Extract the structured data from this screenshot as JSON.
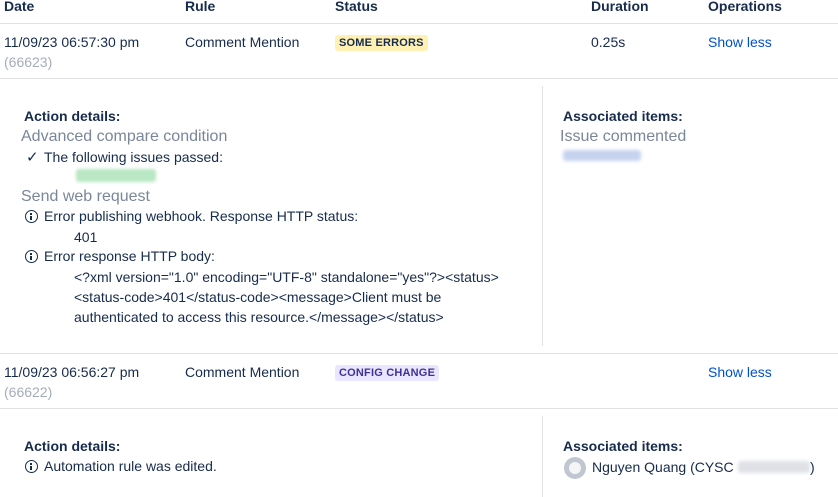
{
  "table": {
    "columns": [
      "Date",
      "Rule",
      "Status",
      "Duration",
      "Operations"
    ]
  },
  "rows": [
    {
      "date": "11/09/23 06:57:30 pm",
      "id": "(66623)",
      "rule": "Comment Mention",
      "status": "SOME ERRORS",
      "duration": "0.25s",
      "operation": "Show less",
      "details": {
        "heading": "Action details:",
        "compare_title": "Advanced compare condition",
        "compare_line": "The following issues passed:",
        "web_title": "Send web request",
        "error1_line": "Error publishing webhook. Response HTTP status:",
        "error1_code": "401",
        "error2_line": "Error response HTTP body:",
        "body_lines": [
          "<?xml version=\"1.0\" encoding=\"UTF-8\" standalone=\"yes\"?><status>",
          "<status-code>401</status-code><message>Client must be",
          "authenticated to access this resource.</message></status>"
        ]
      },
      "associated": {
        "heading": "Associated items:",
        "item": "Issue commented"
      }
    },
    {
      "date": "11/09/23 06:56:27 pm",
      "id": "(66622)",
      "rule": "Comment Mention",
      "status": "CONFIG CHANGE",
      "duration": "",
      "operation": "Show less",
      "details": {
        "heading": "Action details:",
        "line": "Automation rule was edited."
      },
      "associated": {
        "heading": "Associated items:",
        "user_prefix": "Nguyen Quang (CYSC",
        "user_suffix": ")"
      }
    }
  ],
  "icons": {
    "check": "check-icon",
    "info": "info-icon",
    "avatar": "user-avatar-icon"
  },
  "colors": {
    "link": "#0052cc",
    "some_errors_bg": "#fff0b3",
    "config_change_bg": "#eae6ff",
    "config_change_text": "#403294"
  }
}
